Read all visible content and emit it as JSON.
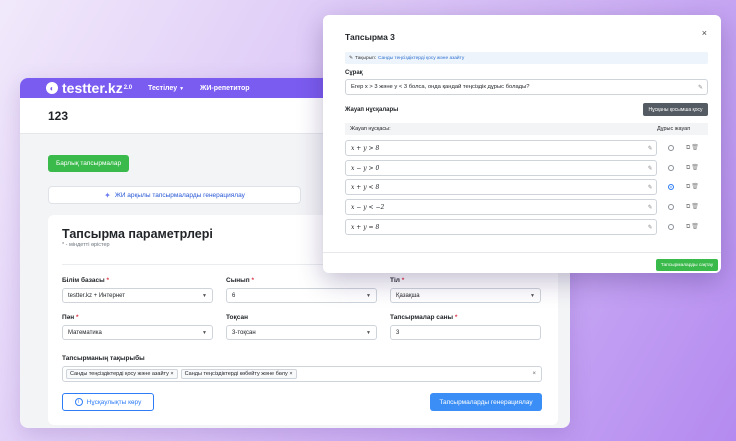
{
  "app": {
    "logo_text": "testter.kz",
    "logo_sup": "2.0",
    "nav": [
      {
        "label": "Тестілеу"
      },
      {
        "label": "ЖИ-репетитор"
      }
    ],
    "page_title": "123",
    "all_tasks_button": "Барлық тапсырмалар",
    "ai_generate_label": "ЖИ арқылы тапсырмаларды генерациялау"
  },
  "form": {
    "title": "Тапсырма параметрлері",
    "required_note": "* - міндетті өрістер",
    "fields": {
      "knowledge_base": {
        "label": "Білім базасы",
        "value": "testter.kz + Интернет"
      },
      "grade": {
        "label": "Сынып",
        "value": "6"
      },
      "language": {
        "label": "Тіл",
        "value": "Қазақша"
      },
      "subject": {
        "label": "Пән",
        "value": "Математика"
      },
      "quarter": {
        "label": "Тоқсан",
        "value": "3-тоқсан"
      },
      "task_count": {
        "label": "Тапсырмалар саны",
        "value": "3"
      }
    },
    "topics_label": "Тапсырманың тақырыбы",
    "topics": [
      {
        "label": "Санды теңсіздіктерді қосу және азайту"
      },
      {
        "label": "Санды теңсіздіктерді көбейту және бөлу"
      }
    ],
    "instruction_button": "Нұсқаулықты көру",
    "generate_button": "Тапсырмаларды генерациялау"
  },
  "modal": {
    "title": "Тапсырма 3",
    "topic_label": "Тақырып:",
    "topic_value": "Санды теңсіздіктерді қосу және азайту",
    "question_label": "Сұрақ",
    "question_text": "Егер x > 3 және y < 3 болса, онда қандай теңсіздік дұрыс болады?",
    "answers_label": "Жауап нұсқалары",
    "add_answer_button": "Нұсқаны қосымша қосу",
    "col_answer": "Жауап нұсқасы:",
    "col_correct": "Дұрыс жауап",
    "answers": [
      {
        "text": "x + y > 8"
      },
      {
        "text": "x − y > 0"
      },
      {
        "text": "x + y < 8"
      },
      {
        "text": "x − y < −2"
      },
      {
        "text": "x + y = 8"
      }
    ],
    "correct_index": 2,
    "save_button": "Тапсырмаларды сақтау"
  },
  "colors": {
    "nav": "#7b5cf0",
    "green": "#3aba4b",
    "blue": "#3a8ef6"
  }
}
